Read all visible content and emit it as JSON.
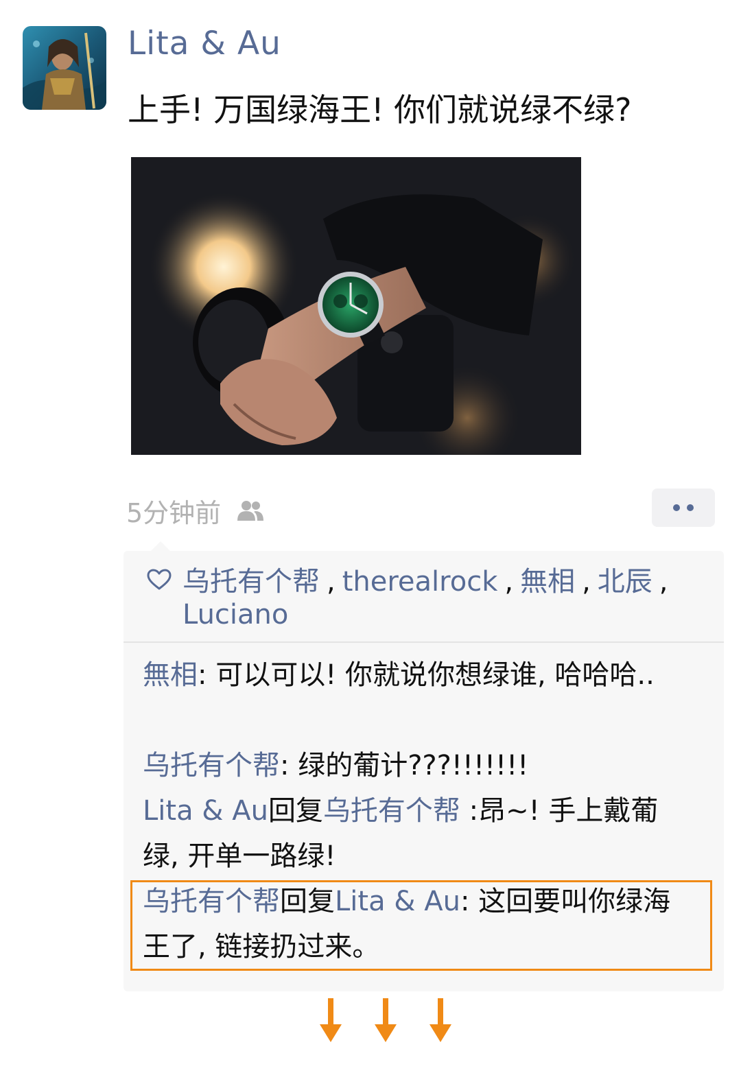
{
  "post": {
    "author": "Lita & Au",
    "text": "上手! 万国绿海王! 你们就说绿不绿?",
    "timestamp": "5分钟前",
    "avatar_icon": "avatar-image",
    "privacy_icon": "friends-icon",
    "more_icon": "more-dots-icon"
  },
  "likes": {
    "names": [
      "乌托有个帮",
      "therealrock",
      "無相",
      "北辰",
      "Luciano"
    ],
    "separator": ","
  },
  "comments": [
    {
      "author": "無相",
      "colon": ":",
      "text": "可以可以! 你就说你想绿谁, 哈哈哈.."
    },
    {
      "author": "乌托有个帮",
      "colon": ":",
      "text": "绿的葡计???!!!!!!!"
    },
    {
      "author": "Lita & Au",
      "reply_word": "回复",
      "reply_to": "乌托有个帮",
      "colon": ":",
      "text": "昂~! 手上戴葡绿, 开单一路绿!"
    },
    {
      "author": "乌托有个帮",
      "reply_word": "回复",
      "reply_to": "Lita & Au",
      "colon": ":",
      "text": " 这回要叫你绿海王了, 链接扔过来。"
    }
  ],
  "colors": {
    "name_blue": "#576b95",
    "highlight_orange": "#f08a16",
    "timestamp_gray": "#b2b2b2"
  }
}
